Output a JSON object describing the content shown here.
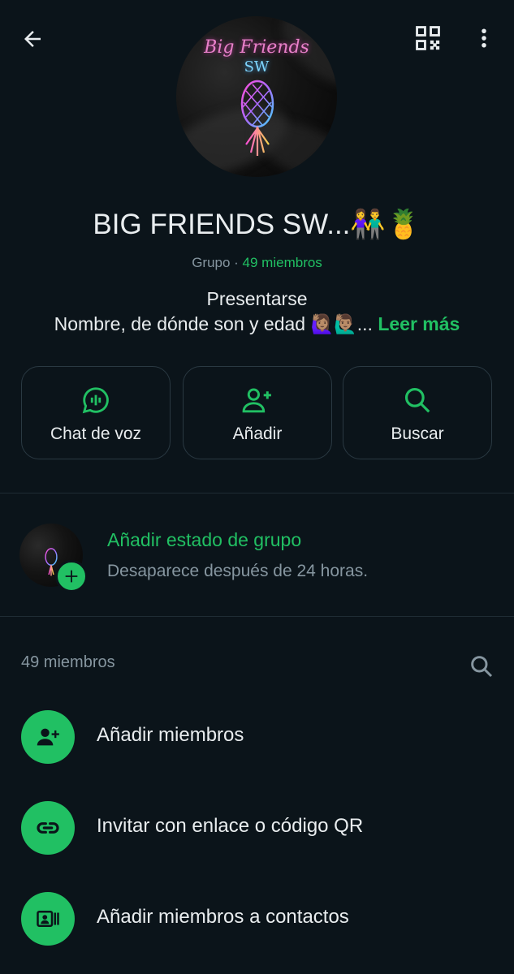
{
  "group": {
    "name": "BIG FRIENDS SW...",
    "name_emoji": "👫🍍",
    "type_label": "Grupo",
    "separator": " · ",
    "members_label": "49 miembros",
    "avatar_title": "Big Friends",
    "avatar_subtitle": "SW"
  },
  "description": {
    "line1": "Presentarse",
    "line2": "Nombre, de dónde son y edad 🙋🏽‍♀️🙋🏽‍♂️...",
    "read_more": "Leer más"
  },
  "actions": [
    {
      "label": "Chat de voz",
      "icon": "voice-chat-icon"
    },
    {
      "label": "Añadir",
      "icon": "add-person-icon"
    },
    {
      "label": "Buscar",
      "icon": "search-icon"
    }
  ],
  "status": {
    "title": "Añadir estado de grupo",
    "subtitle": "Desaparece después de 24 horas."
  },
  "members": {
    "count_label": "49 miembros",
    "rows": [
      {
        "label": "Añadir miembros",
        "icon": "add-member-icon"
      },
      {
        "label": "Invitar con enlace o código QR",
        "icon": "link-icon"
      },
      {
        "label": "Añadir miembros a contactos",
        "icon": "contacts-icon"
      }
    ]
  },
  "colors": {
    "background": "#0b141a",
    "accent": "#21c063",
    "text": "#e9edef",
    "secondary_text": "#8696a0"
  }
}
